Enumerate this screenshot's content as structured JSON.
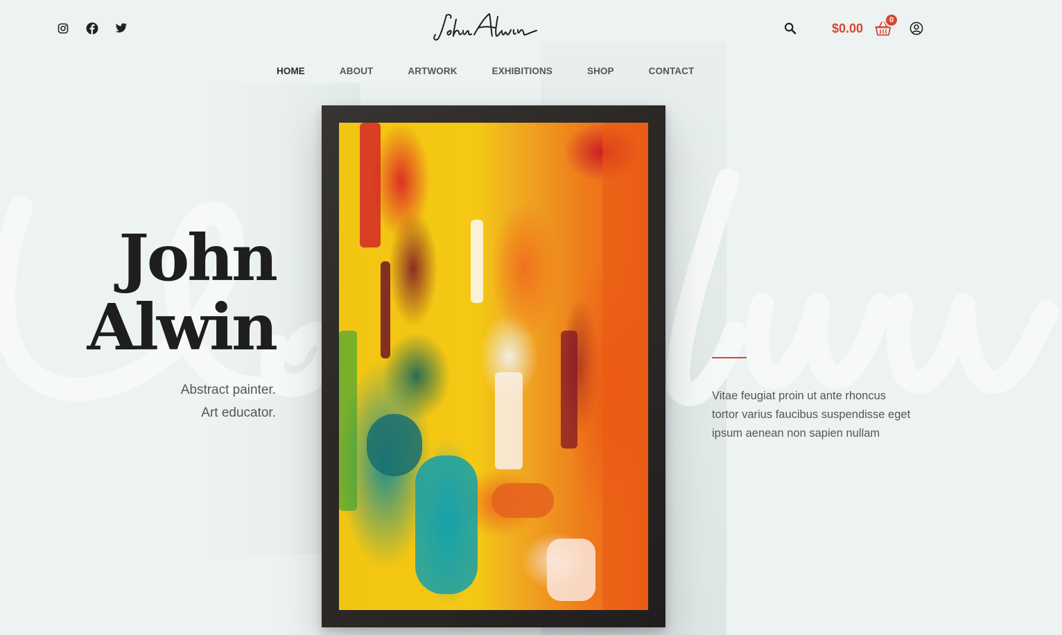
{
  "header": {
    "social": [
      {
        "name": "instagram-icon"
      },
      {
        "name": "facebook-icon"
      },
      {
        "name": "twitter-icon"
      }
    ],
    "logo_text": "JohnAlwin",
    "cart_total": "$0.00",
    "cart_count": "0",
    "icons": {
      "search": "search-icon",
      "cart": "basket-icon",
      "account": "user-circle-icon"
    }
  },
  "nav": {
    "items": [
      {
        "label": "HOME"
      },
      {
        "label": "ABOUT"
      },
      {
        "label": "ARTWORK"
      },
      {
        "label": "EXHIBITIONS"
      },
      {
        "label": "SHOP"
      },
      {
        "label": "CONTACT"
      }
    ]
  },
  "hero": {
    "first_name": "John",
    "last_name": "Alwin",
    "subtitle_line1": "Abstract painter.",
    "subtitle_line2": "Art educator.",
    "blurb": "Vitae feugiat proin ut ante rhoncus tortor varius faucibus suspendisse eget ipsum aenean non sapien nullam"
  },
  "colors": {
    "background": "#edf3f2",
    "accent": "#d9462f",
    "text": "#1e1e1e",
    "frame": "#2b2826"
  }
}
